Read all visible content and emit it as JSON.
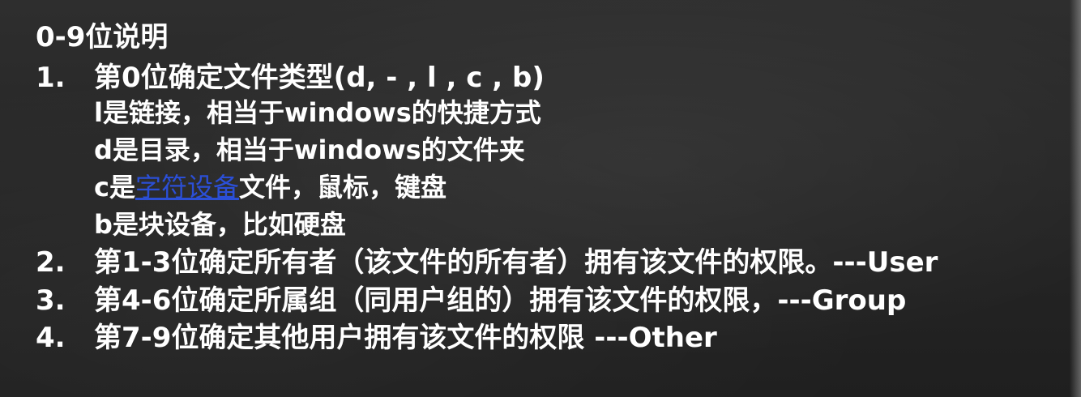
{
  "title": "0-9位说明",
  "items": [
    {
      "num": "1.",
      "text": "第0位确定文件类型(d, - , l , c , b)"
    },
    {
      "num": "2.",
      "text": "第1-3位确定所有者（该文件的所有者）拥有该文件的权限。---User"
    },
    {
      "num": "3.",
      "text": "第4-6位确定所属组（同用户组的）拥有该文件的权限，---Group"
    },
    {
      "num": "4.",
      "text": "第7-9位确定其他用户拥有该文件的权限 ---Other"
    }
  ],
  "subitems": [
    {
      "text": "l是链接，相当于windows的快捷方式"
    },
    {
      "text": "d是目录，相当于windows的文件夹"
    },
    {
      "pre": "c是",
      "link": "字符设备",
      "post": "文件，鼠标，键盘"
    },
    {
      "text": "b是块设备，比如硬盘"
    }
  ]
}
